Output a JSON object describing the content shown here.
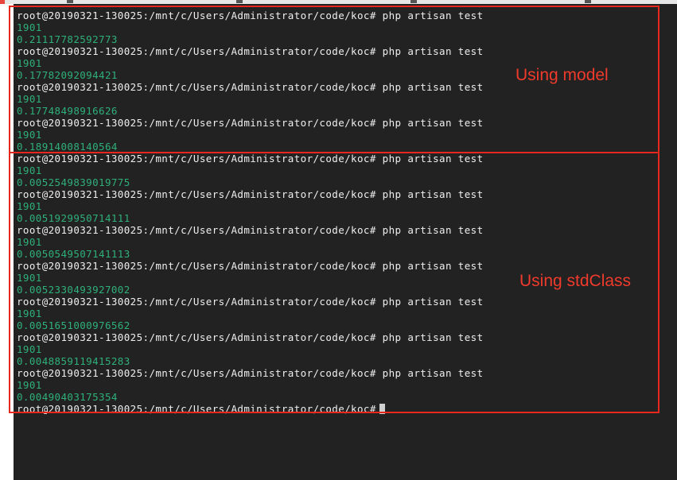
{
  "terminal": {
    "lines": [
      {
        "kind": "prompt",
        "text": "root@20190321-130025:/mnt/c/Users/Administrator/code/koc# php artisan test"
      },
      {
        "kind": "output",
        "text": "1901"
      },
      {
        "kind": "output",
        "text": "0.21117782592773"
      },
      {
        "kind": "prompt",
        "text": "root@20190321-130025:/mnt/c/Users/Administrator/code/koc# php artisan test"
      },
      {
        "kind": "output",
        "text": "1901"
      },
      {
        "kind": "output",
        "text": "0.17782092094421"
      },
      {
        "kind": "prompt",
        "text": "root@20190321-130025:/mnt/c/Users/Administrator/code/koc# php artisan test"
      },
      {
        "kind": "output",
        "text": "1901"
      },
      {
        "kind": "output",
        "text": "0.17748498916626"
      },
      {
        "kind": "prompt",
        "text": "root@20190321-130025:/mnt/c/Users/Administrator/code/koc# php artisan test"
      },
      {
        "kind": "output",
        "text": "1901"
      },
      {
        "kind": "output",
        "text": "0.18914008140564"
      },
      {
        "kind": "prompt",
        "text": "root@20190321-130025:/mnt/c/Users/Administrator/code/koc# php artisan test"
      },
      {
        "kind": "output",
        "text": "1901"
      },
      {
        "kind": "output",
        "text": "0.0052549839019775"
      },
      {
        "kind": "prompt",
        "text": "root@20190321-130025:/mnt/c/Users/Administrator/code/koc# php artisan test"
      },
      {
        "kind": "output",
        "text": "1901"
      },
      {
        "kind": "output",
        "text": "0.0051929950714111"
      },
      {
        "kind": "prompt",
        "text": "root@20190321-130025:/mnt/c/Users/Administrator/code/koc# php artisan test"
      },
      {
        "kind": "output",
        "text": "1901"
      },
      {
        "kind": "output",
        "text": "0.0050549507141113"
      },
      {
        "kind": "prompt",
        "text": "root@20190321-130025:/mnt/c/Users/Administrator/code/koc# php artisan test"
      },
      {
        "kind": "output",
        "text": "1901"
      },
      {
        "kind": "output",
        "text": "0.0052330493927002"
      },
      {
        "kind": "prompt",
        "text": "root@20190321-130025:/mnt/c/Users/Administrator/code/koc# php artisan test"
      },
      {
        "kind": "output",
        "text": "1901"
      },
      {
        "kind": "output",
        "text": "0.0051651000976562"
      },
      {
        "kind": "prompt",
        "text": "root@20190321-130025:/mnt/c/Users/Administrator/code/koc# php artisan test"
      },
      {
        "kind": "output",
        "text": "1901"
      },
      {
        "kind": "output",
        "text": "0.0048859119415283"
      },
      {
        "kind": "prompt",
        "text": "root@20190321-130025:/mnt/c/Users/Administrator/code/koc# php artisan test"
      },
      {
        "kind": "output",
        "text": "1901"
      },
      {
        "kind": "output",
        "text": "0.00490403175354"
      },
      {
        "kind": "prompt",
        "text": "root@20190321-130025:/mnt/c/Users/Administrator/code/koc#",
        "cursor": true
      }
    ]
  },
  "annotations": {
    "model_label": "Using model",
    "stdclass_label": "Using stdClass",
    "box_color": "#e8271e"
  },
  "colors": {
    "terminal_bg": "#222222",
    "prompt_text": "#eeeeee",
    "output_text": "#2fb07a"
  }
}
